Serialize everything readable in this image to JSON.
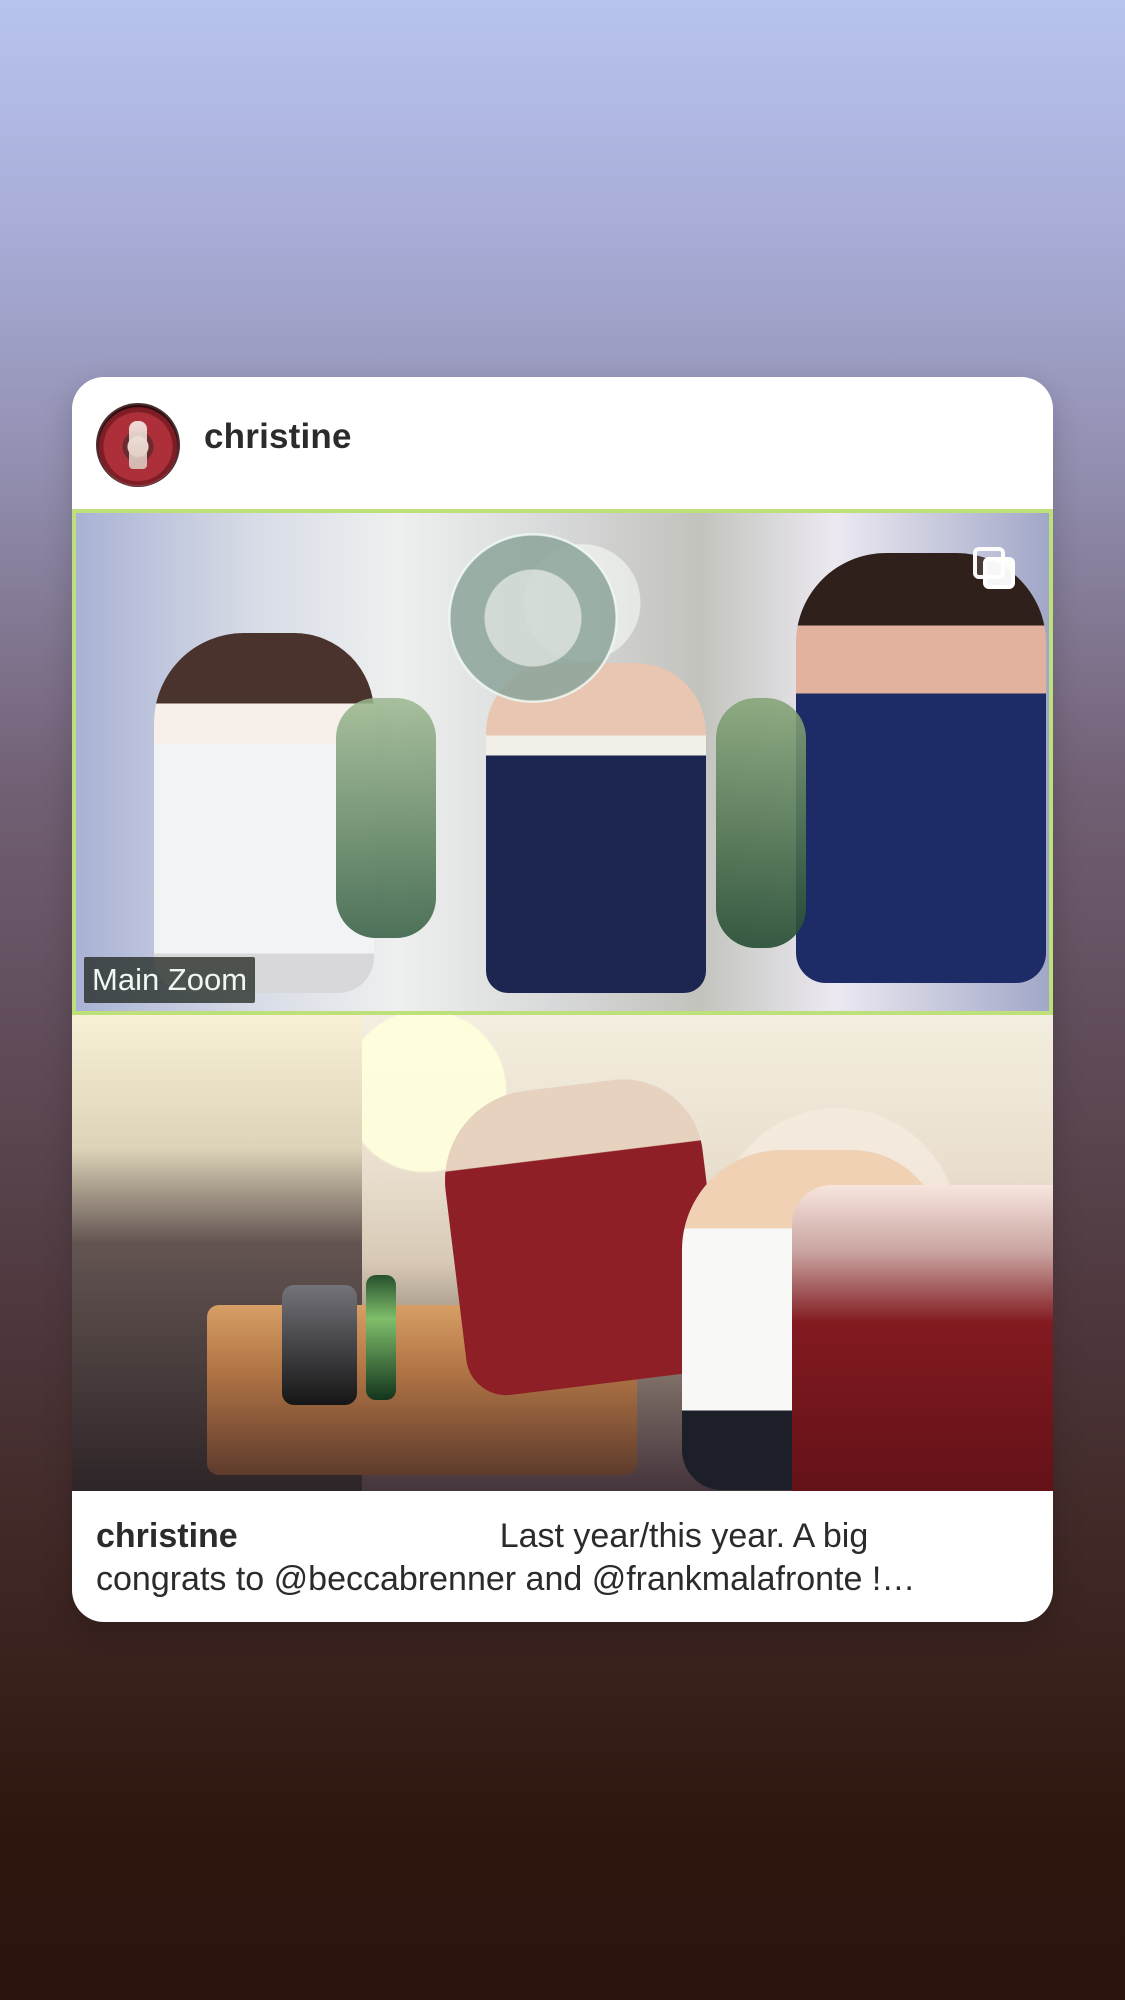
{
  "post": {
    "username": "christine",
    "photo_label": "Main Zoom",
    "caption_username": "christine",
    "caption_text_line1": "Last year/this year. A big",
    "caption_text_line2": "congrats to @beccabrenner and @frankmalafronte !…"
  },
  "icons": {
    "avatar": "profile-avatar",
    "multi": "multiple-images-icon"
  }
}
